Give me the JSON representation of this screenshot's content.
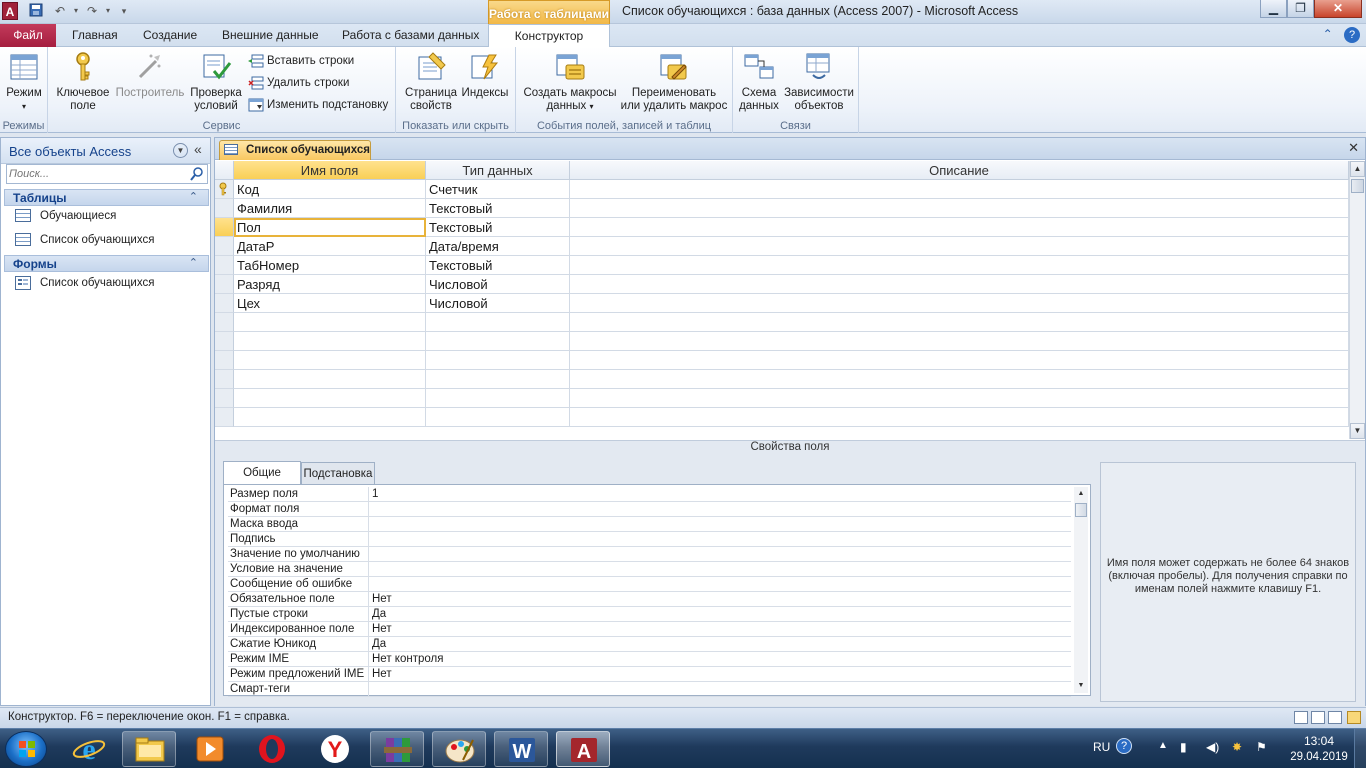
{
  "window": {
    "app_icon": "A",
    "title": "Список обучающихся : база данных (Access 2007)  -  Microsoft Access",
    "context_tab_header": "Работа с таблицами",
    "controls": {
      "minimize": "▁",
      "maximize": "❐",
      "close": "✕"
    }
  },
  "ribbon_tabs": {
    "file": "Файл",
    "tabs": [
      "Главная",
      "Создание",
      "Внешние данные",
      "Работа с базами данных",
      "Конструктор"
    ],
    "active_tab": "Конструктор"
  },
  "ribbon": {
    "groups": {
      "views": "Режимы",
      "tools": "Сервис",
      "show_hide": "Показать или скрыть",
      "events": "События полей, записей и таблиц",
      "relationships": "Связи"
    },
    "buttons": {
      "view": "Режим",
      "primary_key_1": "Ключевое",
      "primary_key_2": "поле",
      "builder": "Построитель",
      "test_rules_1": "Проверка",
      "test_rules_2": "условий",
      "insert_rows": "Вставить строки",
      "delete_rows": "Удалить строки",
      "modify_lookups": "Изменить подстановку",
      "property_sheet_1": "Страница",
      "property_sheet_2": "свойств",
      "indexes": "Индексы",
      "create_macros_1": "Создать макросы",
      "create_macros_2": "данных",
      "rename_macro_1": "Переименовать",
      "rename_macro_2": "или удалить макрос",
      "relationships_1": "Схема",
      "relationships_2": "данных",
      "dependencies_1": "Зависимости",
      "dependencies_2": "объектов"
    }
  },
  "nav": {
    "title": "Все объекты Access",
    "search_placeholder": "Поиск...",
    "sections": [
      {
        "title": "Таблицы",
        "items": [
          "Обучающиеся",
          "Список обучающихся"
        ]
      },
      {
        "title": "Формы",
        "items": [
          "Список обучающихся"
        ]
      }
    ]
  },
  "document": {
    "tab_label": "Список обучающихся",
    "columns": [
      "Имя поля",
      "Тип данных",
      "Описание"
    ],
    "rows": [
      {
        "name": "Код",
        "type": "Счетчик",
        "desc": "",
        "primary_key": true
      },
      {
        "name": "Фамилия",
        "type": "Текстовый",
        "desc": ""
      },
      {
        "name": "Пол",
        "type": "Текстовый",
        "desc": "",
        "current": true
      },
      {
        "name": "ДатаР",
        "type": "Дата/время",
        "desc": ""
      },
      {
        "name": "ТабНомер",
        "type": "Текстовый",
        "desc": ""
      },
      {
        "name": "Разряд",
        "type": "Числовой",
        "desc": ""
      },
      {
        "name": "Цех",
        "type": "Числовой",
        "desc": ""
      }
    ],
    "field_properties_title": "Свойства поля",
    "property_tabs": [
      "Общие",
      "Подстановка"
    ],
    "properties": [
      {
        "name": "Размер поля",
        "value": "1"
      },
      {
        "name": "Формат поля",
        "value": ""
      },
      {
        "name": "Маска ввода",
        "value": ""
      },
      {
        "name": "Подпись",
        "value": ""
      },
      {
        "name": "Значение по умолчанию",
        "value": ""
      },
      {
        "name": "Условие на значение",
        "value": ""
      },
      {
        "name": "Сообщение об ошибке",
        "value": ""
      },
      {
        "name": "Обязательное поле",
        "value": "Нет"
      },
      {
        "name": "Пустые строки",
        "value": "Да"
      },
      {
        "name": "Индексированное поле",
        "value": "Нет"
      },
      {
        "name": "Сжатие Юникод",
        "value": "Да"
      },
      {
        "name": "Режим IME",
        "value": "Нет контроля"
      },
      {
        "name": "Режим предложений IME",
        "value": "Нет"
      },
      {
        "name": "Смарт-теги",
        "value": ""
      }
    ],
    "help_text": "Имя поля может содержать не более 64 знаков (включая пробелы). Для получения справки по именам полей нажмите клавишу F1."
  },
  "status": {
    "text": "Конструктор.  F6 = переключение окон.  F1 = справка."
  },
  "taskbar": {
    "language": "RU",
    "time": "13:04",
    "date": "29.04.2019",
    "apps": [
      "file-explorer",
      "media-player",
      "opera",
      "yandex-browser",
      "winrar",
      "paint",
      "word",
      "access"
    ]
  }
}
